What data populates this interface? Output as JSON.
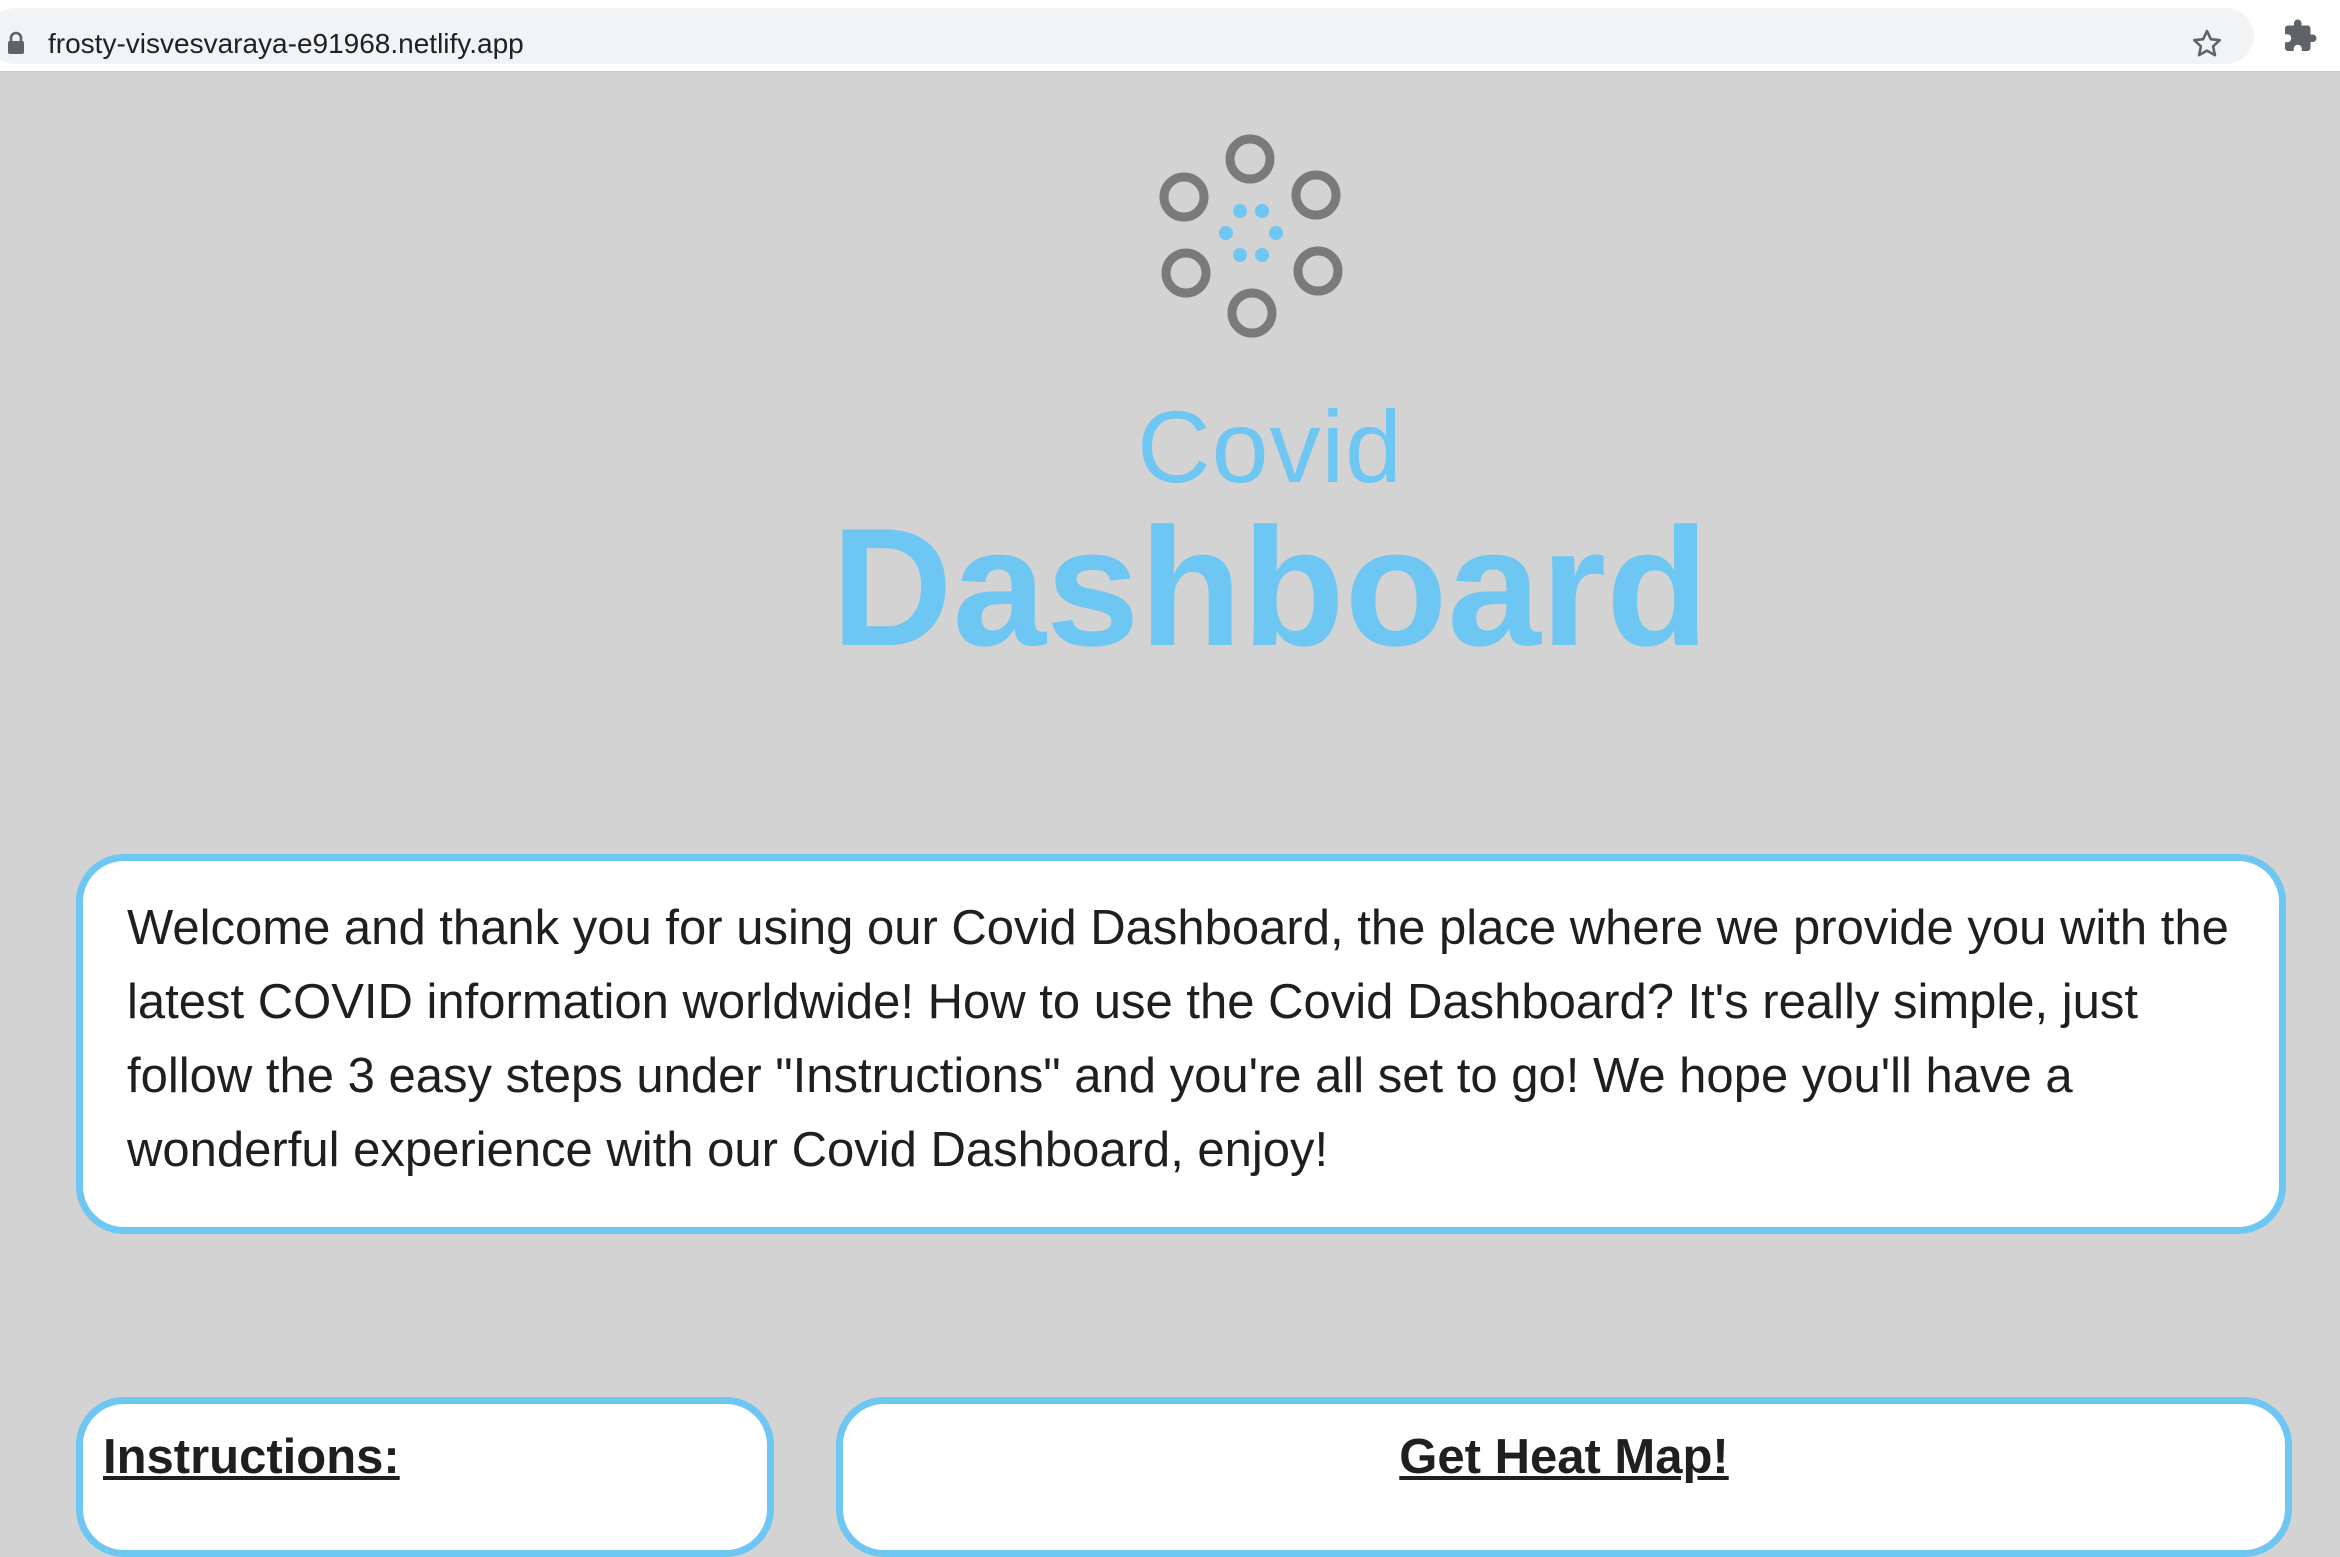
{
  "browser": {
    "url": "frosty-visvesvaraya-e91968.netlify.app"
  },
  "logo": {
    "line1": "Covid",
    "line2": "Dashboard"
  },
  "welcome": {
    "text": "Welcome and thank you for using our Covid Dashboard, the place where we provide you with the latest COVID information worldwide! How to use the Covid Dashboard? It's really simple, just follow the 3 easy steps under \"Instructions\" and you're all set to go! We hope you'll have a wonderful experience with our Covid Dashboard, enjoy!"
  },
  "instructions": {
    "heading": "Instructions:"
  },
  "heatmap": {
    "heading": "Get Heat Map!"
  },
  "colors": {
    "accent": "#6ec6f2",
    "background": "#d3d3d3",
    "logo_ring": "#7a7a7a"
  }
}
